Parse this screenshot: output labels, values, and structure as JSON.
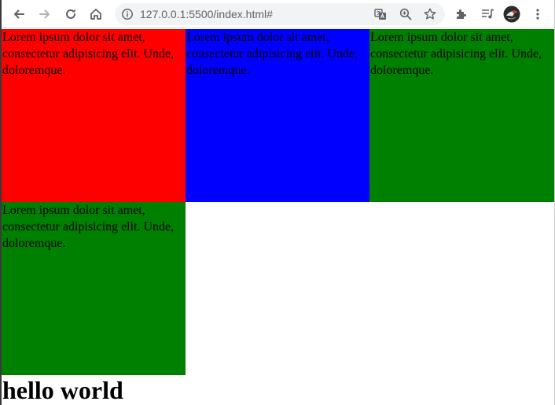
{
  "browser": {
    "url": "127.0.0.1:5500/index.html#",
    "icons": {
      "back": "arrow-left-icon",
      "forward": "arrow-right-icon",
      "reload": "reload-icon",
      "home": "home-icon",
      "site_info": "info-icon",
      "translate": "translate-icon",
      "zoom": "zoom-icon",
      "bookmark": "star-icon",
      "extensions": "puzzle-icon",
      "media": "media-queue-icon",
      "profile": "avatar",
      "menu": "kebab-menu-icon"
    }
  },
  "page": {
    "boxes": [
      {
        "text": "Lorem ipsum dolor sit amet, consectetur adipisicing elit. Unde, doloremque.",
        "color": "#ff0000"
      },
      {
        "text": "Lorem ipsum dolor sit amet, consectetur adipisicing elit. Unde, doloremque.",
        "color": "#0000ff"
      },
      {
        "text": "Lorem ipsum dolor sit amet, consectetur adipisicing elit. Unde, doloremque.",
        "color": "#008000"
      },
      {
        "text": "Lorem ipsum dolor sit amet, consectetur adipisicing elit. Unde, doloremque.",
        "color": "#008000"
      }
    ],
    "heading": "hello world"
  }
}
